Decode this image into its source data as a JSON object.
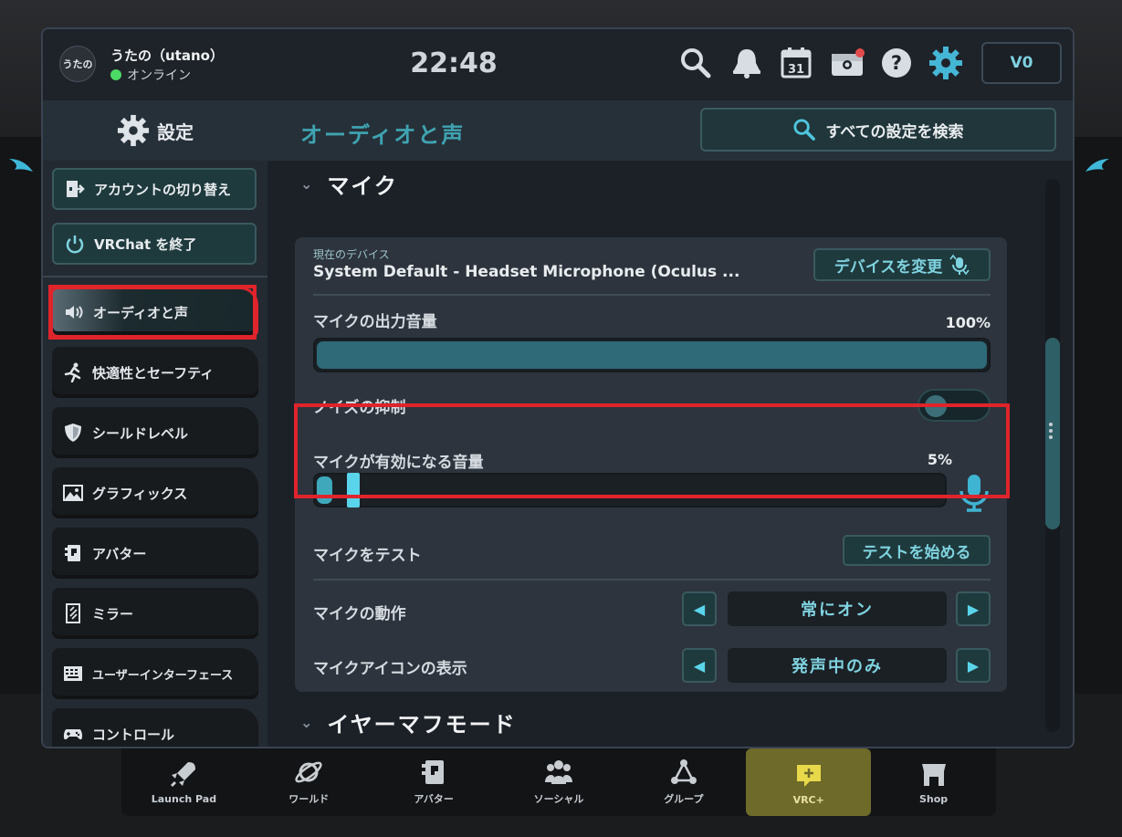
{
  "user": {
    "avatar_text": "うたの",
    "name": "うたの（utano）",
    "status": "オンライン"
  },
  "clock": "22:48",
  "topbar": {
    "icons": [
      "search-icon",
      "bell-icon",
      "calendar-icon",
      "store-icon",
      "help-icon",
      "gear-icon"
    ],
    "calendar_day": "31",
    "vc_balance": "V0"
  },
  "sidebar": {
    "title": "設定",
    "buttons": [
      {
        "label": "アカウントの切り替え",
        "icon": "account-switch-icon"
      },
      {
        "label": "VRChat を終了",
        "icon": "power-icon"
      }
    ],
    "items": [
      {
        "label": "オーディオと声",
        "icon": "speaker-icon",
        "active": true
      },
      {
        "label": "快適性とセーフティ",
        "icon": "running-icon"
      },
      {
        "label": "シールドレベル",
        "icon": "shield-icon"
      },
      {
        "label": "グラフィックス",
        "icon": "image-icon"
      },
      {
        "label": "アバター",
        "icon": "avatar-icon"
      },
      {
        "label": "ミラー",
        "icon": "mirror-icon"
      },
      {
        "label": "ユーザーインターフェース",
        "icon": "keyboard-icon"
      },
      {
        "label": "コントロール",
        "icon": "gamepad-icon"
      }
    ]
  },
  "content": {
    "title": "オーディオと声",
    "search_all": "すべての設定を検索",
    "section_mic": "マイク",
    "device_label": "現在のデバイス",
    "device_name": "System Default - Headset Microphone (Oculus ...",
    "change_device": "デバイスを変更",
    "mic_volume_label": "マイクの出力音量",
    "mic_volume_value": "100%",
    "mic_volume_level": 1.0,
    "noise_label": "ノイズの抑制",
    "noise_enabled": false,
    "threshold_label": "マイクが有効になる音量",
    "threshold_value": "5%",
    "threshold_level": 0.05,
    "test_label": "マイクをテスト",
    "test_button": "テストを始める",
    "behavior_label": "マイクの動作",
    "behavior_value": "常にオン",
    "icon_display_label": "マイクアイコンの表示",
    "icon_display_value": "発声中のみ",
    "section_earmuff": "イヤーマフモード"
  },
  "dock": [
    {
      "label": "Launch Pad",
      "icon": "rocket-icon"
    },
    {
      "label": "ワールド",
      "icon": "planet-icon"
    },
    {
      "label": "アバター",
      "icon": "avatar-icon"
    },
    {
      "label": "ソーシャル",
      "icon": "people-icon"
    },
    {
      "label": "グループ",
      "icon": "group-icon"
    },
    {
      "label": "VRC+",
      "icon": "vrcplus-icon"
    },
    {
      "label": "Shop",
      "icon": "shop-icon"
    }
  ],
  "colors": {
    "accent": "#5ad4ea",
    "highlight": "#e0242b",
    "online": "#4cd964"
  }
}
